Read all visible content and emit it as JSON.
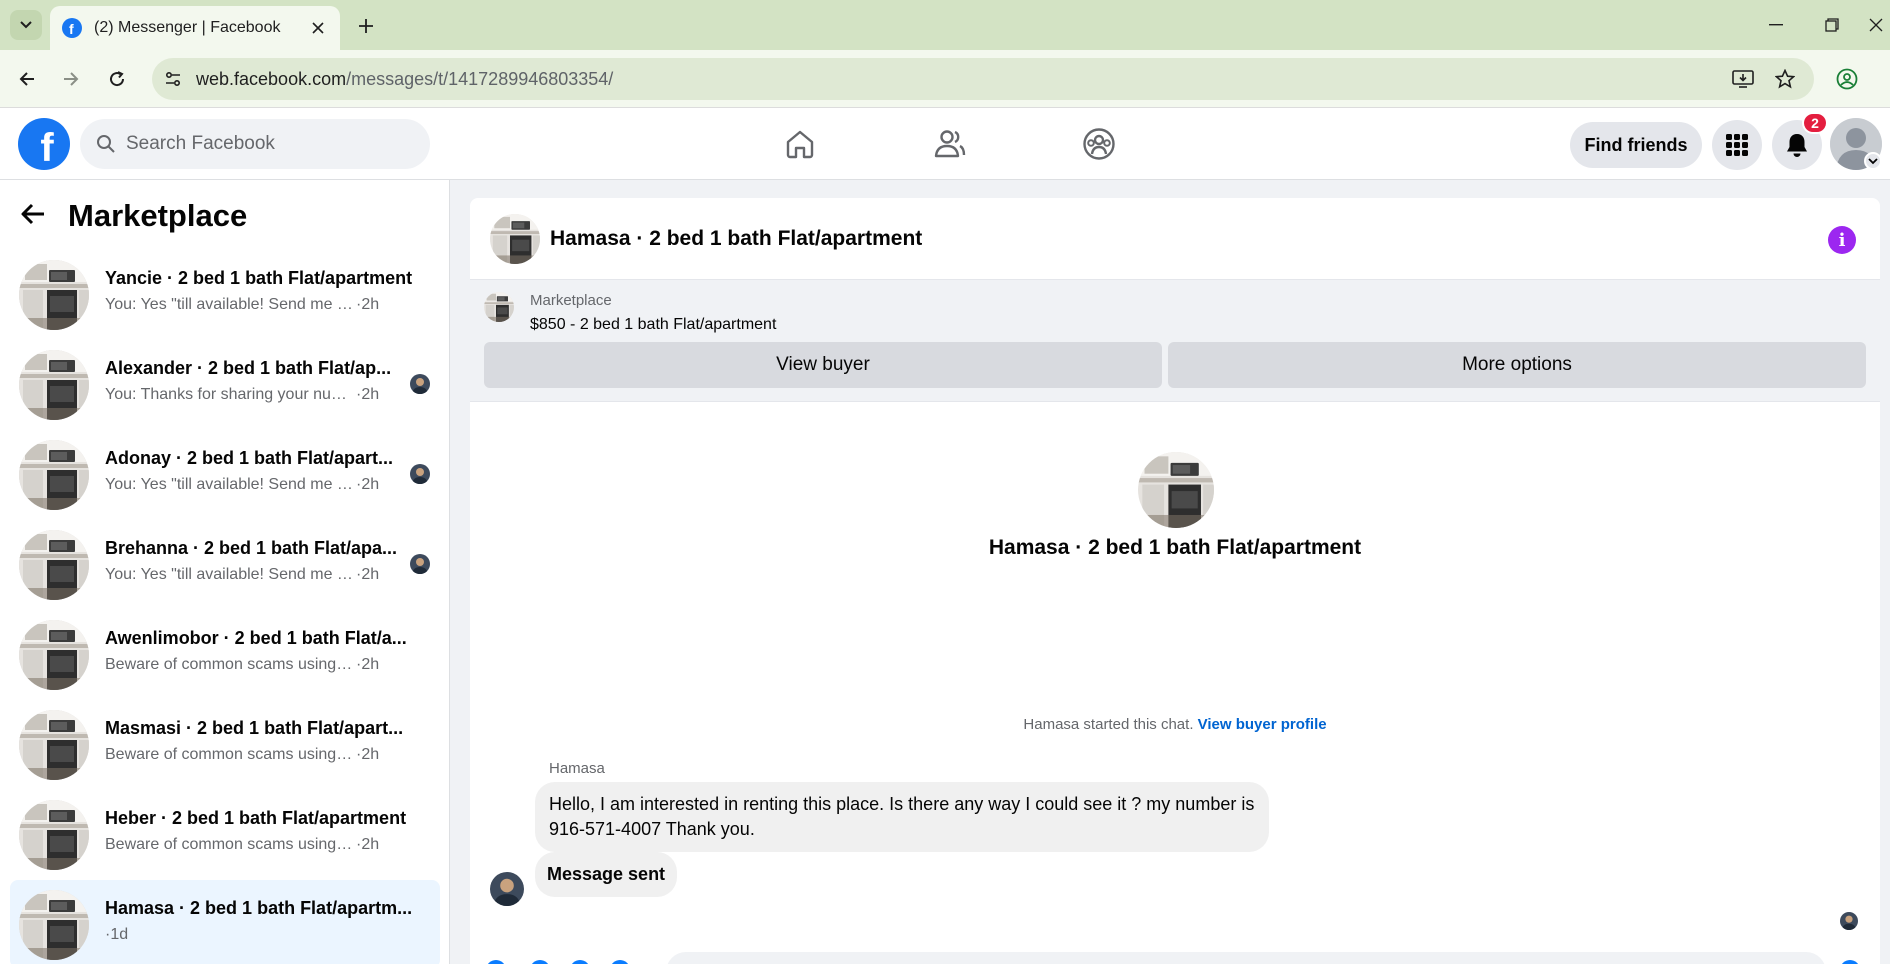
{
  "browser": {
    "tab_title": "(2) Messenger | Facebook",
    "url_domain": "web.facebook.com",
    "url_path": "/messages/t/1417289946803354/"
  },
  "header": {
    "search_placeholder": "Search Facebook",
    "find_friends_label": "Find friends",
    "notification_count": "2",
    "brand_color": "#1877f2"
  },
  "sidebar": {
    "title": "Marketplace",
    "conversations": [
      {
        "name": "Yancie · 2 bed 1 bath Flat/apartment",
        "preview": "You: Yes \"till available! Send me your ...",
        "time": "·2h",
        "active": false
      },
      {
        "name": "Alexander · 2 bed 1 bath Flat/ap...",
        "preview": "You: Thanks for sharing your number",
        "time": "·2h",
        "active": false
      },
      {
        "name": "Adonay · 2 bed 1 bath Flat/apart...",
        "preview": "You: Yes \"till available! Send me yo...",
        "time": "·2h",
        "active": false
      },
      {
        "name": "Brehanna · 2 bed 1 bath Flat/apa...",
        "preview": "You: Yes \"till available! Send me yo...",
        "time": "·2h",
        "active": false
      },
      {
        "name": "Awenlimobor · 2 bed 1 bath Flat/a...",
        "preview": "Beware of common scams using pay...",
        "time": "·2h",
        "active": false
      },
      {
        "name": "Masmasi · 2 bed 1 bath Flat/apart...",
        "preview": "Beware of common scams using pay...",
        "time": "·2h",
        "active": false
      },
      {
        "name": "Heber · 2 bed 1 bath Flat/apartment",
        "preview": "Beware of common scams using pay...",
        "time": "·2h",
        "active": false
      },
      {
        "name": "Hamasa · 2 bed 1 bath Flat/apartm...",
        "preview": "",
        "time": "·1d",
        "active": true
      }
    ]
  },
  "chat": {
    "title": "Hamasa · 2 bed 1 bath Flat/apartment",
    "marketplace_label": "Marketplace",
    "listing": "$850 - 2 bed 1 bath Flat/apartment",
    "view_buyer_label": "View buyer",
    "more_options_label": "More options",
    "center_title": "Hamasa · 2 bed 1 bath Flat/apartment",
    "started_text": "Hamasa started this chat.",
    "view_profile_link": "View buyer profile",
    "sender_name": "Hamasa",
    "messages": [
      {
        "text": "Hello, I am interested in renting this place.  Is there any way I could see it ? my number is 916-571-4007 Thank you."
      },
      {
        "text": "Message sent"
      }
    ],
    "info_color": "#9c27f0"
  }
}
